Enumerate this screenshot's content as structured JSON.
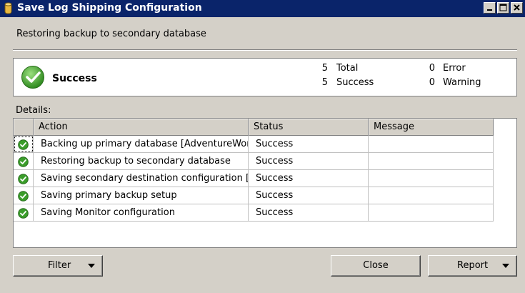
{
  "window": {
    "title": "Save Log Shipping Configuration",
    "controls": [
      "minimize",
      "maximize",
      "close"
    ]
  },
  "header": {
    "text": "Restoring backup to secondary database"
  },
  "summary": {
    "status_label": "Success",
    "status_icon": "success-check-icon",
    "total_count": "5",
    "total_label": "Total",
    "success_count": "5",
    "success_label": "Success",
    "error_count": "0",
    "error_label": "Error",
    "warning_count": "0",
    "warning_label": "Warning"
  },
  "details": {
    "label": "Details:",
    "columns": [
      "",
      "Action",
      "Status",
      "Message"
    ],
    "rows": [
      {
        "icon": "success-check-icon",
        "action": "Backing up primary database [AdventureWor...",
        "status": "Success",
        "message": ""
      },
      {
        "icon": "success-check-icon",
        "action": "Restoring backup to secondary database",
        "status": "Success",
        "message": ""
      },
      {
        "icon": "success-check-icon",
        "action": "Saving secondary destination configuration [...",
        "status": "Success",
        "message": ""
      },
      {
        "icon": "success-check-icon",
        "action": "Saving primary backup setup",
        "status": "Success",
        "message": ""
      },
      {
        "icon": "success-check-icon",
        "action": "Saving Monitor configuration",
        "status": "Success",
        "message": ""
      }
    ]
  },
  "buttons": {
    "filter": "Filter",
    "close": "Close",
    "report": "Report"
  },
  "colors": {
    "titlebar": "#0a246a",
    "success_green": "#3a9d2a",
    "dialog_bg": "#d4d0c8"
  }
}
